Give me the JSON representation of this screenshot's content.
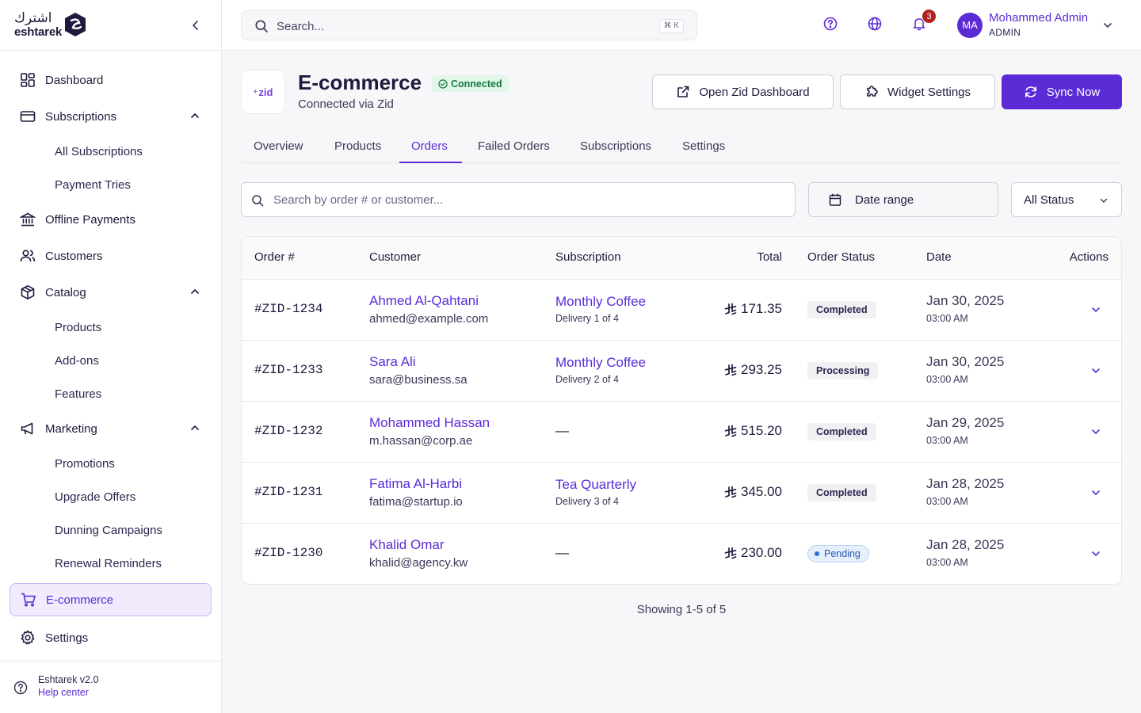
{
  "brand": {
    "arabic": "اشترك",
    "latin": "eshtarek"
  },
  "sidebar": {
    "items": [
      {
        "label": "Dashboard",
        "icon": "grid-icon"
      },
      {
        "label": "Subscriptions",
        "icon": "credit-card-icon",
        "children": [
          "All Subscriptions",
          "Payment Tries"
        ]
      },
      {
        "label": "Offline Payments",
        "icon": "bank-icon"
      },
      {
        "label": "Customers",
        "icon": "users-icon"
      },
      {
        "label": "Catalog",
        "icon": "package-icon",
        "children": [
          "Products",
          "Add-ons",
          "Features"
        ]
      },
      {
        "label": "Marketing",
        "icon": "megaphone-icon",
        "children": [
          "Promotions",
          "Upgrade Offers",
          "Dunning Campaigns",
          "Renewal Reminders"
        ]
      },
      {
        "label": "E-commerce",
        "icon": "cart-icon",
        "active": true
      },
      {
        "label": "Settings",
        "icon": "gear-icon"
      }
    ],
    "footer": {
      "version": "Eshtarek v2.0",
      "help": "Help center"
    }
  },
  "header": {
    "search_placeholder": "Search...",
    "shortcut": "⌘ K",
    "notifications": "3",
    "user": {
      "initials": "MA",
      "name": "Mohammed Admin",
      "role": "ADMIN"
    }
  },
  "page": {
    "logo_text": "zid",
    "title": "E-commerce",
    "status": "Connected",
    "subtitle": "Connected via Zid",
    "buttons": {
      "open": "Open Zid Dashboard",
      "widget": "Widget Settings",
      "sync": "Sync Now"
    },
    "tabs": [
      "Overview",
      "Products",
      "Orders",
      "Failed Orders",
      "Subscriptions",
      "Settings"
    ],
    "active_tab": "Orders"
  },
  "filters": {
    "search_placeholder": "Search by order # or customer...",
    "date_range": "Date range",
    "status": "All Status"
  },
  "table": {
    "columns": [
      "Order #",
      "Customer",
      "Subscription",
      "Total",
      "Order Status",
      "Date",
      "Actions"
    ],
    "rows": [
      {
        "order": "#ZID-1234",
        "name": "Ahmed Al-Qahtani",
        "email": "ahmed@example.com",
        "sub": "Monthly Coffee",
        "delivery": "Delivery 1 of 4",
        "total": "171.35",
        "status": "Completed",
        "date": "Jan 30, 2025",
        "time": "03:00 AM"
      },
      {
        "order": "#ZID-1233",
        "name": "Sara Ali",
        "email": "sara@business.sa",
        "sub": "Monthly Coffee",
        "delivery": "Delivery 2 of 4",
        "total": "293.25",
        "status": "Processing",
        "date": "Jan 30, 2025",
        "time": "03:00 AM"
      },
      {
        "order": "#ZID-1232",
        "name": "Mohammed Hassan",
        "email": "m.hassan@corp.ae",
        "sub": "—",
        "delivery": "",
        "total": "515.20",
        "status": "Completed",
        "date": "Jan 29, 2025",
        "time": "03:00 AM"
      },
      {
        "order": "#ZID-1231",
        "name": "Fatima Al-Harbi",
        "email": "fatima@startup.io",
        "sub": "Tea Quarterly",
        "delivery": "Delivery 3 of 4",
        "total": "345.00",
        "status": "Completed",
        "date": "Jan 28, 2025",
        "time": "03:00 AM"
      },
      {
        "order": "#ZID-1230",
        "name": "Khalid Omar",
        "email": "khalid@agency.kw",
        "sub": "—",
        "delivery": "",
        "total": "230.00",
        "status": "Pending",
        "date": "Jan 28, 2025",
        "time": "03:00 AM"
      }
    ],
    "showing": "Showing 1-5 of 5"
  },
  "colors": {
    "accent": "#5b2bd6",
    "success": "#157a3f",
    "danger": "#b3211c"
  }
}
